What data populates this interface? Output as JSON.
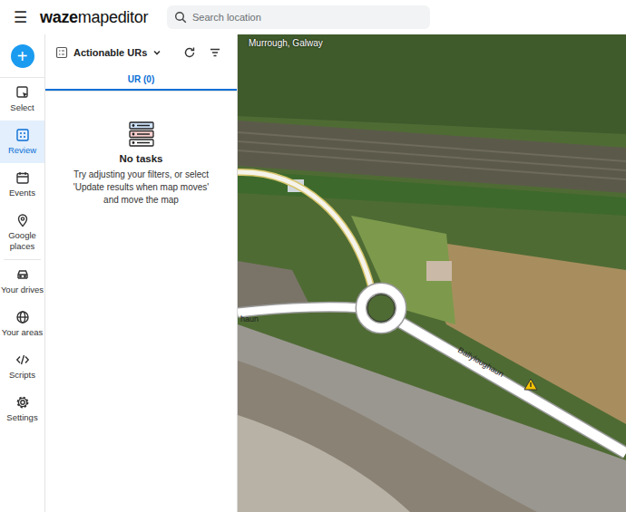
{
  "topbar": {
    "menu": "☰",
    "logo": {
      "brand": "waze",
      "product": "mapeditor"
    },
    "search": {
      "placeholder": "Search location"
    }
  },
  "nav": {
    "add": "+",
    "items": [
      {
        "label": "Select",
        "selected": false
      },
      {
        "label": "Review",
        "selected": true
      },
      {
        "label": "Events",
        "selected": false
      },
      {
        "label": "Google places",
        "selected": false
      },
      {
        "label": "Your drives",
        "selected": false
      },
      {
        "label": "Your areas",
        "selected": false
      },
      {
        "label": "Scripts",
        "selected": false
      },
      {
        "label": "Settings",
        "selected": false
      }
    ]
  },
  "panel": {
    "dropdown": "Actionable URs",
    "tabs": [
      {
        "label": "UR (0)",
        "selected": true
      }
    ],
    "empty": {
      "title": "No tasks",
      "message": "Try adjusting your filters, or select 'Update results when map moves' and move the map"
    }
  },
  "map": {
    "location": "Murrough, Galway",
    "roads": [
      {
        "label": "Ballyloughaun"
      },
      {
        "label": "haun"
      }
    ]
  }
}
